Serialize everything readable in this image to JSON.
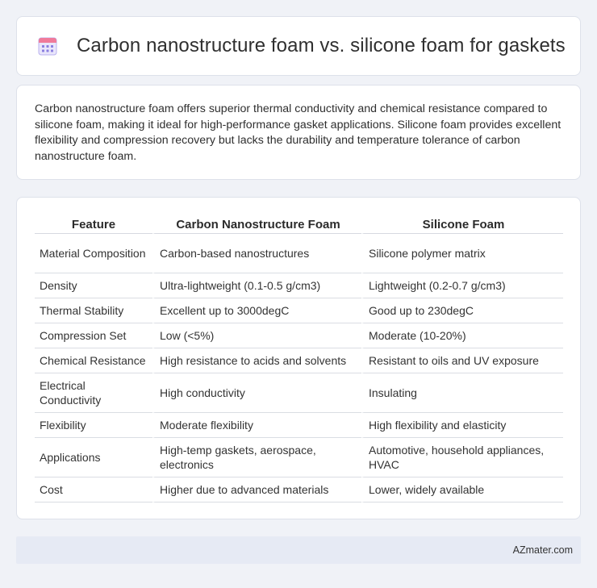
{
  "header": {
    "icon": "calendar-icon",
    "title": "Carbon nanostructure foam vs. silicone foam for gaskets"
  },
  "summary": {
    "text": "Carbon nanostructure foam offers superior thermal conductivity and chemical resistance compared to silicone foam, making it ideal for high-performance gasket applications. Silicone foam provides excellent flexibility and compression recovery but lacks the durability and temperature tolerance of carbon nanostructure foam."
  },
  "table": {
    "headers": [
      "Feature",
      "Carbon Nanostructure Foam",
      "Silicone Foam"
    ],
    "rows": [
      [
        "Material Composition",
        "Carbon-based nanostructures",
        "Silicone polymer matrix"
      ],
      [
        "Density",
        "Ultra-lightweight (0.1-0.5 g/cm3)",
        "Lightweight (0.2-0.7 g/cm3)"
      ],
      [
        "Thermal Stability",
        "Excellent up to 3000degC",
        "Good up to 230degC"
      ],
      [
        "Compression Set",
        "Low (<5%)",
        "Moderate (10-20%)"
      ],
      [
        "Chemical Resistance",
        "High resistance to acids and solvents",
        "Resistant to oils and UV exposure"
      ],
      [
        "Electrical Conductivity",
        "High conductivity",
        "Insulating"
      ],
      [
        "Flexibility",
        "Moderate flexibility",
        "High flexibility and elasticity"
      ],
      [
        "Applications",
        "High-temp gaskets, aerospace, electronics",
        "Automotive, household appliances, HVAC"
      ],
      [
        "Cost",
        "Higher due to advanced materials",
        "Lower, widely available"
      ]
    ]
  },
  "footer": {
    "text": "AZmater.com"
  },
  "colors": {
    "background": "#f0f2f7",
    "card": "#ffffff",
    "footer_bg": "#e6eaf4",
    "icon_purple": "#8b7fe0",
    "icon_pink": "#f07a9a"
  }
}
